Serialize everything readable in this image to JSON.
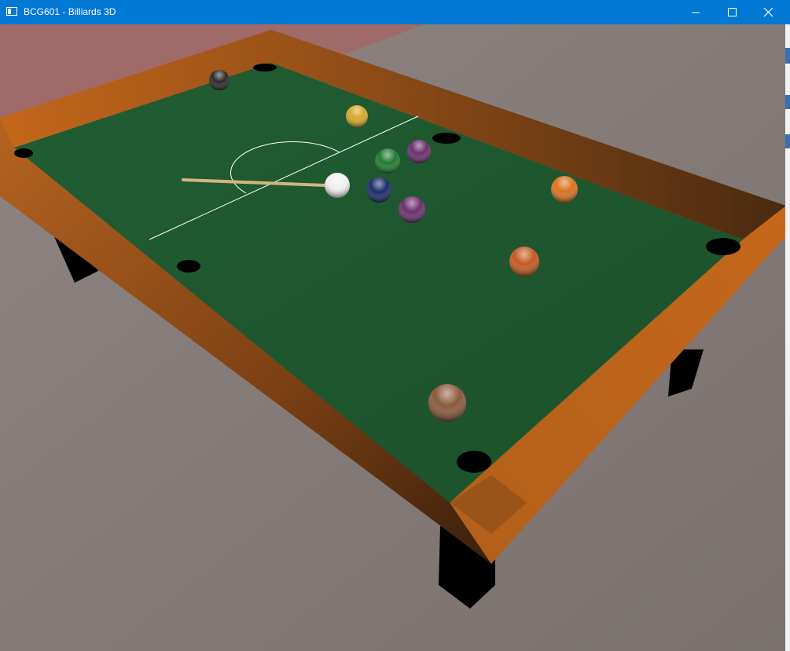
{
  "window": {
    "title": "BCG601 - Billiards 3D",
    "titlebar_color": "#0078d4",
    "buttons": {
      "minimize": "minimize-icon",
      "maximize": "maximize-icon",
      "close": "close-icon"
    }
  },
  "scene": {
    "floor_color": "#857b78",
    "wall_color": "#a06a68",
    "felt_color": "#1f5a30",
    "rail_color": "#b3621c",
    "cue_color": "#d2b481",
    "balls": [
      {
        "name": "black",
        "color": "#2a2a2a"
      },
      {
        "name": "yellow",
        "color": "#d4a928"
      },
      {
        "name": "green",
        "color": "#1f7a33"
      },
      {
        "name": "purple",
        "color": "#6b2f6e"
      },
      {
        "name": "cue-ball",
        "color": "#f0f0f0"
      },
      {
        "name": "navy",
        "color": "#1b2c6a"
      },
      {
        "name": "purple-2",
        "color": "#6b2f6e"
      },
      {
        "name": "orange",
        "color": "#d9731f"
      },
      {
        "name": "orange-red",
        "color": "#c45a22"
      },
      {
        "name": "brown",
        "color": "#8a5a3c"
      }
    ]
  }
}
